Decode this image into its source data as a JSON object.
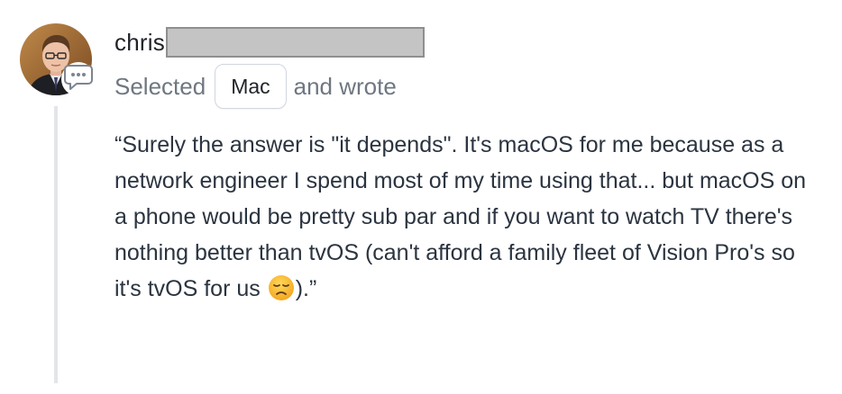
{
  "author": {
    "name_visible": "chris",
    "redacted": true
  },
  "meta": {
    "prefix": "Selected",
    "choice": "Mac",
    "suffix": "and wrote"
  },
  "comment": {
    "text_before_emoji": "“Surely the answer is \"it depends\". It's macOS for me because as a network engineer I spend most of my time using that... but macOS on a phone would be pretty sub par and if you want to watch TV there's nothing better than tvOS (can't afford a family fleet of Vision Pro's so it's tvOS for us ",
    "emoji": "disappointed-face",
    "text_after_emoji": ").”"
  },
  "icons": {
    "comment_badge": "speech-bubble-icon"
  },
  "colors": {
    "text": "#2b3440",
    "muted": "#6e7781",
    "thread_line": "#e3e5e8",
    "redaction_fill": "#c4c4c4"
  }
}
